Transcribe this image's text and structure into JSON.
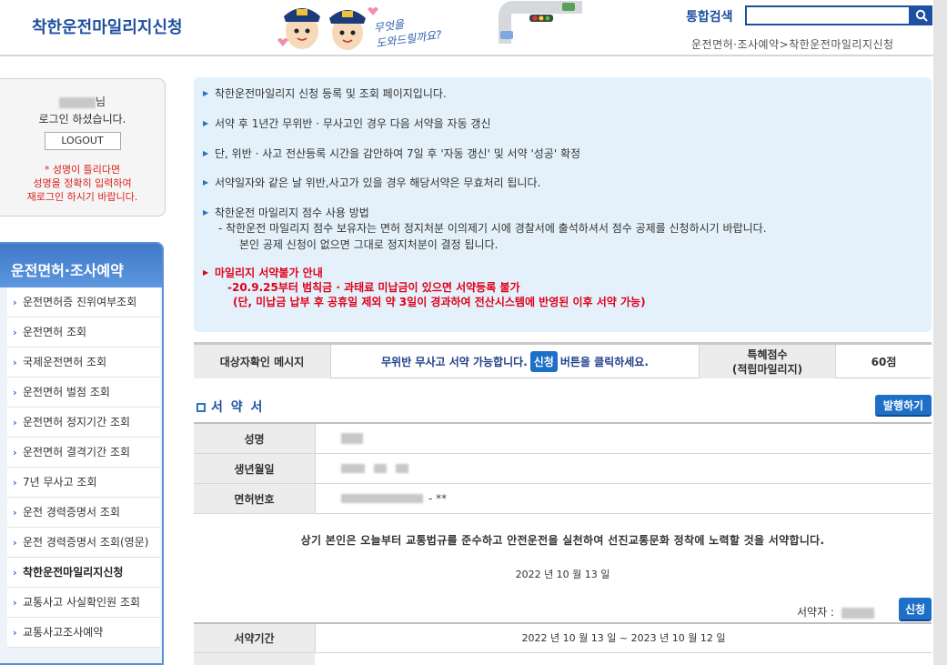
{
  "header": {
    "site_title": "착한운전마일리지신청",
    "mascot_text_1": "무엇을",
    "mascot_text_2": "도와드릴까요?",
    "search_label": "통합검색",
    "search_value": "",
    "breadcrumb": "운전면허·조사예약>착한운전마일리지신청"
  },
  "login": {
    "name_suffix": "님",
    "status": "로그인 하셨습니다.",
    "logout_label": "LOGOUT",
    "warning_1": "* 성명이 틀리다면",
    "warning_2": "성명을 정확히 입력하여",
    "warning_3": "재로그인 하시기 바랍니다."
  },
  "menu": {
    "title": "운전면허·조사예약",
    "items": [
      {
        "label": "운전면허증 진위여부조회",
        "active": false
      },
      {
        "label": "운전면허 조회",
        "active": false
      },
      {
        "label": "국제운전면허 조회",
        "active": false
      },
      {
        "label": "운전면허 벌점 조회",
        "active": false
      },
      {
        "label": "운전면허 정지기간 조회",
        "active": false
      },
      {
        "label": "운전면허 결격기간 조회",
        "active": false
      },
      {
        "label": "7년 무사고 조회",
        "active": false
      },
      {
        "label": "운전 경력증명서 조회",
        "active": false
      },
      {
        "label": "운전 경력증명서 조회(영문)",
        "active": false
      },
      {
        "label": "착한운전마일리지신청",
        "active": true
      },
      {
        "label": "교통사고 사실확인원 조회",
        "active": false
      },
      {
        "label": "교통사고조사예약",
        "active": false
      }
    ]
  },
  "info": {
    "line1": "착한운전마일리지 신청 등록 및 조회 페이지입니다.",
    "line2": "서약 후 1년간 무위반 · 무사고인 경우 다음 서약을 자동 갱신",
    "line3": "단, 위반 · 사고 전산등록 시간을 감안하여 7일 후 '자동 갱신' 및 서약 '성공' 확정",
    "line4": "서약일자와 같은 날 위반,사고가 있을 경우 해당서약은 무효처리 됩니다.",
    "line5": "착한운전 마일리지 점수 사용 방법",
    "line5_sub1": "- 착한운전 마일리지 점수 보유자는 면허 정지처분 이의제기 시에 경찰서에 출석하셔서 점수 공제를 신청하시기 바랍니다.",
    "line5_sub2": "본인 공제 신청이 없으면 그대로 정지처분이 결정 됩니다.",
    "line6": "마일리지 서약불가 안내",
    "line6_sub1": "-20.9.25부터 범칙금 · 과태료 미납금이 있으면 서약등록 불가",
    "line6_sub2": "(단, 미납금 납부 후 공휴일 제외 약 3일이 경과하여 전산시스템에 반영된 이후 서약 가능)"
  },
  "message": {
    "label": "대상자확인 메시지",
    "text_before": "무위반 무사고 서약 가능합니다.",
    "apply_chip": "신청",
    "text_after": "버튼을 클릭하세요.",
    "points_label_1": "특혜점수",
    "points_label_2": "(적립마일리지)",
    "points_value": "60점"
  },
  "pledge": {
    "title": "서 약 서",
    "issue_button": "발행하기",
    "name_label": "성명",
    "birth_label": "생년월일",
    "license_label": "면허번호",
    "license_suffix": "- **",
    "statement": "상기 본인은 오늘부터 교통법규를 준수하고 안전운전을 실천하여 선진교통문화 정착에 노력할 것을 서약합니다.",
    "date": "2022 년 10 월 13 일",
    "signer_label": "서약자 :",
    "apply_button": "신청",
    "period_label": "서약기간",
    "period_value": "2022 년 10 월 13 일 ~ 2023 년 10 월 12 일"
  },
  "colors": {
    "brand": "#1f4fa0",
    "accent": "#1d6fc7",
    "warning": "#e0001b"
  }
}
